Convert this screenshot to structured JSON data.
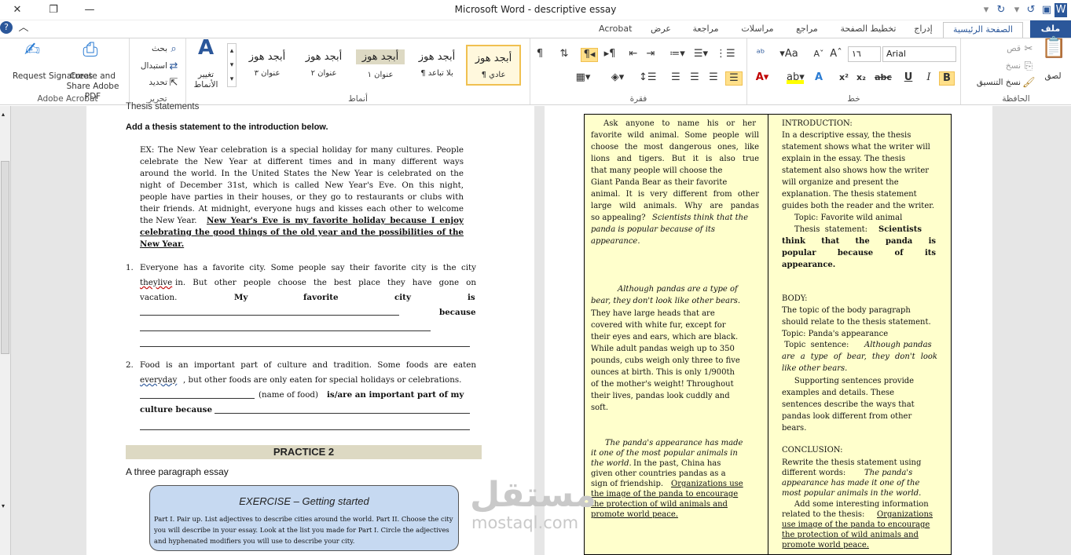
{
  "window": {
    "title": "Microsoft Word  -  descriptive essay"
  },
  "tabs": {
    "file": "ملف",
    "home": "الصفحة الرئيسية",
    "insert": "إدراج",
    "layout": "تخطيط الصفحة",
    "references": "مراجع",
    "mailings": "مراسلات",
    "review": "مراجعة",
    "view": "عرض",
    "acrobat": "Acrobat"
  },
  "ribbon": {
    "clipboard": {
      "label": "الحافظة",
      "paste": "لصق",
      "cut": "قص",
      "copy": "نسخ",
      "format_painter": "نسخ التنسيق"
    },
    "font": {
      "label": "خط",
      "font_name": "Arial",
      "font_size": "١٦"
    },
    "paragraph": {
      "label": "فقرة"
    },
    "styles": {
      "label": "أنماط",
      "sample": "أبجد هوز",
      "normal": "¶ عادي",
      "no_spacing": "¶ بلا تباعد",
      "h1": "عنوان ١",
      "h2": "عنوان ٢",
      "h3": "عنوان ٣"
    },
    "editing": {
      "label": "تحرير",
      "find": "بحث",
      "replace": "استبدال",
      "select": "تحديد",
      "change_styles": "تغيير الأنماط"
    },
    "acrobat": {
      "label": "Adobe Acrobat",
      "create": "Create and Share Adobe PDF",
      "request": "Request Signatures"
    }
  },
  "left_page": {
    "top_cut": "Thesis statements",
    "instruction": "Add a thesis statement to the introduction below.",
    "ex_lines": [
      "EX: The New Year celebration is a special holiday for many cultures. People",
      "celebrate the New Year at different times and in many different ways",
      "around the world. In the United States the New Year is celebrated on the",
      "night of December 31st, which is called New Year's Eve. On this night,",
      "people have parties in their houses, or they go to restaurants or clubs with",
      "their friends. At midnight, everyone hugs and kisses each other to welcome"
    ],
    "ex_last_plain": "the New Year. ",
    "ex_thesis_1": "New Year's Eve is my favorite holiday because I enjoy",
    "ex_thesis_2": "celebrating the good things of the old year and the possibilities of the",
    "ex_thesis_3": "New Year.",
    "item1_num": "1.",
    "item1_l1": "Everyone has a favorite city. Some people say their favorite city is the city",
    "item1_l2a": "theylive",
    "item1_l2b": " in. But other people choose the best place they have gone on",
    "item1_l3": "vacation.",
    "item1_w1": "My",
    "item1_w2": "favorite",
    "item1_w3": "city",
    "item1_w4": "is",
    "item1_because": "because",
    "item2_num": "2.",
    "item2_l1": "Food is an important part of culture and tradition. Some foods are eaten",
    "item2_l2a": "everyday",
    "item2_l2b": ", but other foods are only eaten for special holidays or celebrations.",
    "item2_l3a": "(name of food) ",
    "item2_l3b": "is/are an important part of my",
    "item2_l4": "culture because",
    "practice": "PRACTICE 2",
    "subtitle": "A three paragraph essay",
    "exercise_title": "EXERCISE – Getting started",
    "exercise_lines": [
      "Part I. Pair up. List adjectives to describe cities around the world. Part II. Choose the city",
      "you will describe in your essay. Look at the list you made for Part I. Circle the adjectives",
      "and hyphenated modifiers you will use to describe your city."
    ]
  },
  "right_page": {
    "col1_p1": [
      "Ask anyone to name his or her",
      "favorite wild animal. Some people will",
      "choose the most dangerous ones, like",
      "lions and tigers. But it is also true",
      "that many people will choose the",
      "Giant Panda Bear as their favorite",
      "animal.  It is very different from other",
      "large wild animals.  Why are pandas",
      "so appealing?"
    ],
    "col1_p1_it_a": "Scientists think that the",
    "col1_p1_it_b": "panda is popular because of its",
    "col1_p1_it_c": "appearance.",
    "col1_p2_it": [
      "Although pandas are a type of",
      "bear, they don't look like other bears."
    ],
    "col1_p2": [
      "They have large heads that are",
      "covered with white fur, except for",
      "their eyes and ears, which are black.",
      "While adult pandas weigh up to 350",
      "pounds, cubs weigh only three to five",
      "ounces at birth. This is only 1/900th",
      "of the mother's weight! Throughout",
      "their lives, pandas look cuddly and",
      "soft."
    ],
    "col1_p3_it": [
      "The panda's appearance has made",
      "it one of the most popular animals in",
      "the world."
    ],
    "col1_p3_a": " In the past, China has",
    "col1_p3_b": [
      "given other countries pandas as a",
      "sign of friendship."
    ],
    "col1_p3_u": [
      "Organizations use",
      "the image of the panda to encourage",
      "the protection of wild animals  and",
      "promote world peace."
    ],
    "col2_intro": [
      "INTRODUCTION:",
      "In a descriptive essay, the thesis",
      "statement shows what the writer will",
      "explain in the essay. The thesis",
      "statement also shows how the writer",
      "will organize and present the",
      "explanation.  The thesis statement",
      "guides both the reader and the writer.",
      "     Topic: Favorite wild animal"
    ],
    "col2_thesis_label": "     Thesis  statement: ",
    "col2_thesis_bold": [
      "Scientists",
      "think  that  the  panda  is",
      "popular  because  of  its",
      "appearance."
    ],
    "col2_body": [
      "BODY:",
      "The topic of the body paragraph",
      "should relate to the thesis statement.",
      "Topic: Panda's appearance"
    ],
    "col2_topic_label": " Topic  sentence: ",
    "col2_topic_it": [
      "Although  pandas",
      "are  a  type  of  bear,  they  don't  look",
      "like other bears."
    ],
    "col2_support": [
      "     Supporting sentences provide",
      "examples and details. These",
      "sentences describe the ways that",
      "pandas look different from other",
      "bears."
    ],
    "col2_concl": [
      "CONCLUSION:",
      "Rewrite the thesis statement using"
    ],
    "col2_concl_a": "different words: ",
    "col2_concl_it": [
      "The panda's",
      "appearance has made it one of the",
      "most popular animals in the world."
    ],
    "col2_concl_b": [
      "     Add some interesting information",
      "related to the thesis:"
    ],
    "col2_concl_u": [
      "Organizations",
      "use image of the panda to encourage",
      "the protection of wild animals  and",
      "promote world peace."
    ]
  },
  "watermark": {
    "ar": "مستقل",
    "en": "mostaql.com"
  },
  "colors": {
    "accent": "#2b579a",
    "cell": "#ffffcc",
    "practice_bg": "#ddd9c3",
    "exercise_bg": "#c6d9f1"
  }
}
